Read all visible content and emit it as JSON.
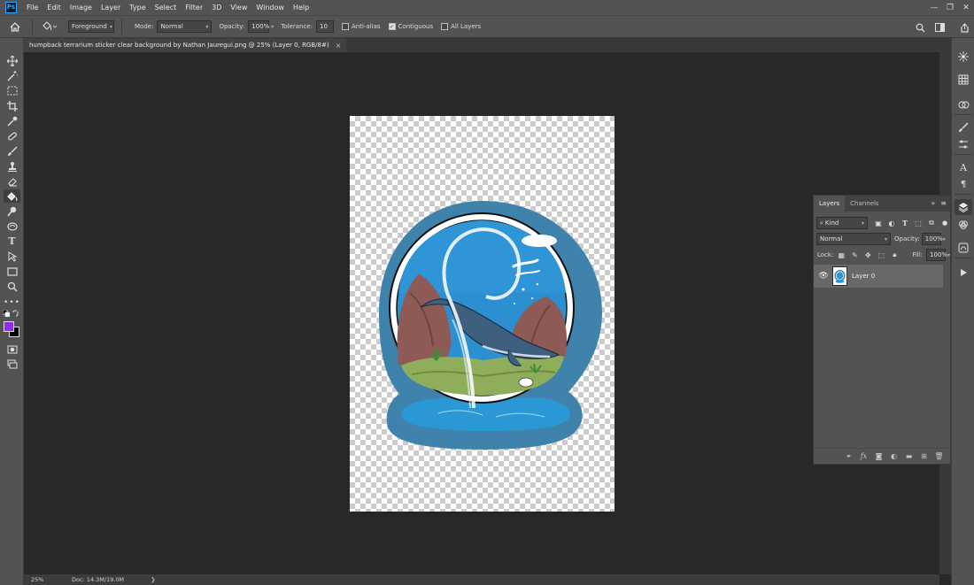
{
  "app": {
    "logo": "Ps"
  },
  "menu": [
    "File",
    "Edit",
    "Image",
    "Layer",
    "Type",
    "Select",
    "Filter",
    "3D",
    "View",
    "Window",
    "Help"
  ],
  "window_controls": {
    "minimize": "—",
    "restore": "❐",
    "close": "✕"
  },
  "options": {
    "source": "Foreground",
    "mode_label": "Mode:",
    "mode": "Normal",
    "opacity_label": "Opacity:",
    "opacity": "100%",
    "tolerance_label": "Tolerance:",
    "tolerance": "10",
    "anti_alias": {
      "label": "Anti-alias",
      "checked": false
    },
    "contiguous": {
      "label": "Contiguous",
      "checked": true
    },
    "all_layers": {
      "label": "All Layers",
      "checked": false
    }
  },
  "document": {
    "tab_title": "humpback terrarium sticker clear background by Nathan Jauregui.png @ 25% (Layer 0, RGB/8#)",
    "close": "×"
  },
  "colors": {
    "foreground": "#8d2df1",
    "background": "#000000",
    "accent": "#31a8ff"
  },
  "status": {
    "zoom": "25%",
    "doc_size": "Doc: 14.3M/19.0M",
    "arrow": "❯"
  },
  "layers_panel": {
    "tabs": [
      "Layers",
      "Channels"
    ],
    "filter_kind": "Kind",
    "blend_mode": "Normal",
    "opacity_label": "Opacity:",
    "opacity": "100%",
    "lock_label": "Lock:",
    "fill_label": "Fill:",
    "fill": "100%",
    "layers": [
      {
        "name": "Layer 0",
        "visible": true
      }
    ]
  }
}
